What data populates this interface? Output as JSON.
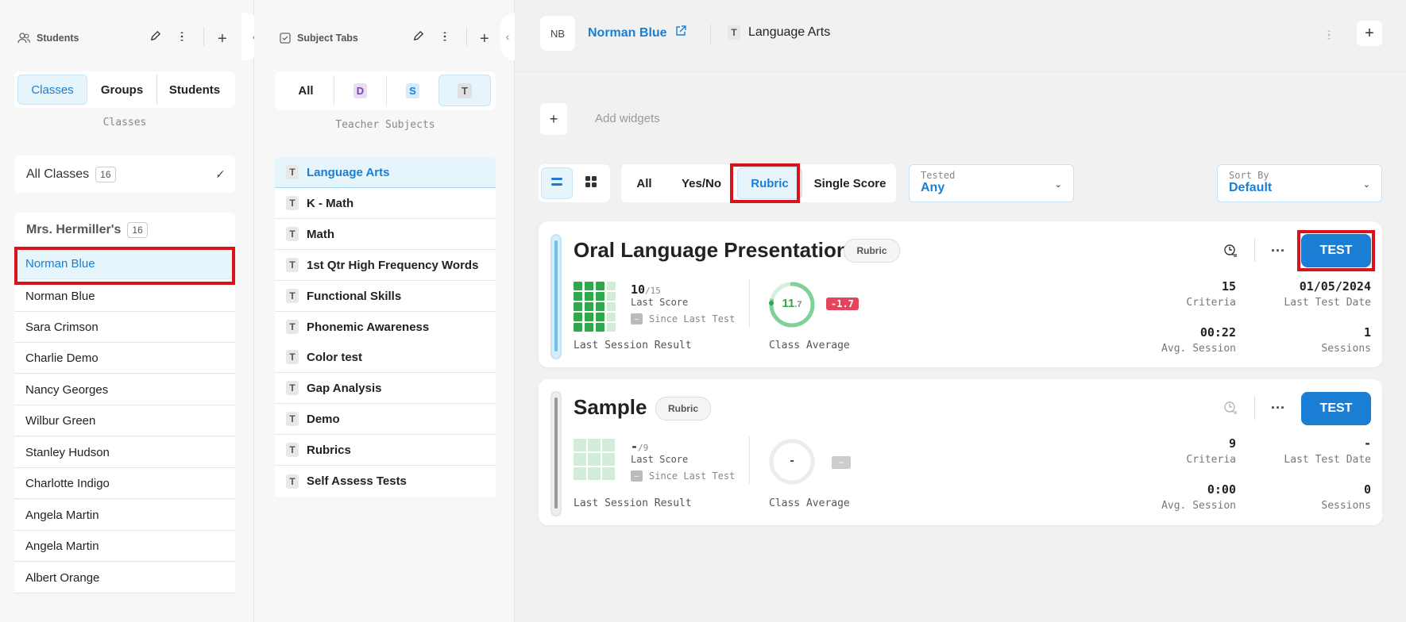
{
  "students_panel": {
    "title": "Students",
    "tabs": [
      "Classes",
      "Groups",
      "Students"
    ],
    "active_tab": "Classes",
    "tab_caption": "Classes",
    "all_classes": {
      "label": "All Classes",
      "count": "16"
    },
    "class_header": {
      "label": "Mrs. Hermiller's",
      "count": "16"
    },
    "students": [
      "Norman Blue",
      "Norman Blue",
      "Sara Crimson",
      "Charlie Demo",
      "Nancy Georges",
      "Wilbur Green",
      "Stanley Hudson",
      "Charlotte Indigo",
      "Angela Martin",
      "Angela Martin",
      "Albert Orange"
    ]
  },
  "subjects_panel": {
    "title": "Subject Tabs",
    "filters": [
      "All",
      "D",
      "S",
      "T"
    ],
    "caption": "Teacher Subjects",
    "subjects": [
      "Language Arts",
      "K - Math",
      "Math",
      "1st Qtr High Frequency Words",
      "Functional Skills",
      "Phonemic Awareness",
      "Color test",
      "Gap Analysis",
      "Demo",
      "Rubrics",
      "Self Assess Tests"
    ],
    "badge": "T"
  },
  "header": {
    "initials": "NB",
    "student_name": "Norman Blue",
    "subject_badge": "T",
    "subject_name": "Language Arts"
  },
  "widgets": {
    "add_label": "Add widgets"
  },
  "filters": {
    "types": [
      "All",
      "Yes/No",
      "Rubric",
      "Single Score"
    ],
    "active_type": "Rubric",
    "tested": {
      "label": "Tested",
      "value": "Any"
    },
    "sort": {
      "label": "Sort By",
      "value": "Default"
    }
  },
  "tests": [
    {
      "name": "Oral Language Presentation",
      "type": "Rubric",
      "test_label": "TEST",
      "score": "10",
      "score_total": "/15",
      "last_score_label": "Last Score",
      "since_label": "Since Last Test",
      "since_value": "–",
      "session_result_label": "Last Session Result",
      "avg_main": "11",
      "avg_dec": ".7",
      "avg_fraction": 0.78,
      "delta": "-1.7",
      "class_avg_label": "Class Average",
      "criteria": "15",
      "criteria_label": "Criteria",
      "last_test_date": "01/05/2024",
      "last_test_date_label": "Last Test Date",
      "avg_session": "00:22",
      "avg_session_label": "Avg. Session",
      "sessions": "1",
      "sessions_label": "Sessions"
    },
    {
      "name": "Sample",
      "type": "Rubric",
      "test_label": "TEST",
      "score": "-",
      "score_total": "/9",
      "last_score_label": "Last Score",
      "since_label": "Since Last Test",
      "since_value": "–",
      "session_result_label": "Last Session Result",
      "avg_main": "-",
      "delta": "–",
      "class_avg_label": "Class Average",
      "criteria": "9",
      "criteria_label": "Criteria",
      "last_test_date": "-",
      "last_test_date_label": "Last Test Date",
      "avg_session": "0:00",
      "avg_session_label": "Avg. Session",
      "sessions": "0",
      "sessions_label": "Sessions"
    }
  ],
  "colors": {
    "accent": "#1a7fd4",
    "highlight": "#d8131b",
    "score_green": "#2ea84a",
    "delta_red": "#e5445c"
  }
}
